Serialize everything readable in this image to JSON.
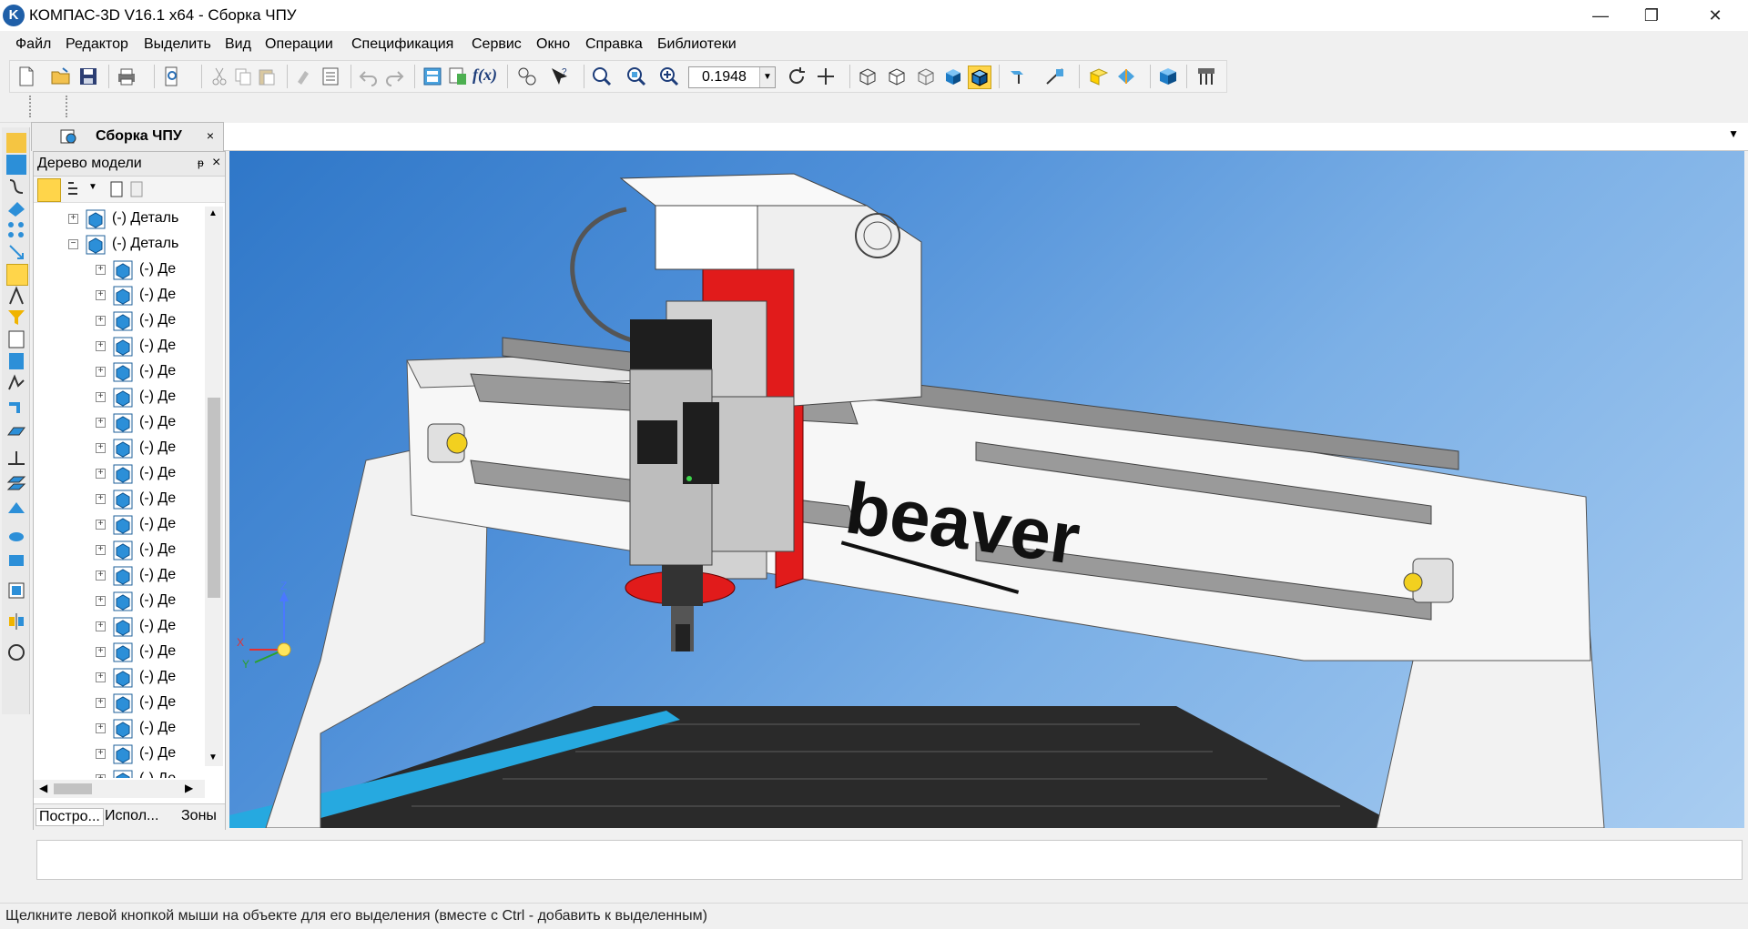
{
  "window": {
    "title": "КОМПАС-3D V16.1 x64 - Сборка ЧПУ",
    "logo_letter": "K",
    "controls": {
      "minimize": "—",
      "restore": "❐",
      "close": "✕"
    }
  },
  "menu": [
    "Файл",
    "Редактор",
    "Выделить",
    "Вид",
    "Операции",
    "Спецификация",
    "Сервис",
    "Окно",
    "Справка",
    "Библиотеки"
  ],
  "toolbar": {
    "zoom_value": "0.1948",
    "fx_label": "f(x)",
    "icons": [
      "new-document-icon",
      "open-folder-icon",
      "save-icon",
      "print-icon",
      "print-preview-icon",
      "cut-icon",
      "copy-icon",
      "paste-icon",
      "format-painter-icon",
      "properties-list-icon",
      "undo-icon",
      "redo-icon",
      "manager-icon",
      "tree-icon",
      "variables-icon",
      "numbering-icon",
      "help-pointer-icon",
      "zoom-window-icon",
      "zoom-fit-icon",
      "zoom-in-icon",
      "rotate-icon",
      "move-icon",
      "wireframe-icon",
      "hidden-lines-icon",
      "hidden-thin-icon",
      "shaded-icon",
      "shaded-edges-icon",
      "section-icon",
      "perspective-icon",
      "planes-icon",
      "orientation-icon",
      "render-icon",
      "settings-icon"
    ]
  },
  "document_tab": {
    "label": "Сборка ЧПУ",
    "close": "×"
  },
  "tree_panel": {
    "title": "Дерево модели",
    "pin": "ᵽ",
    "close": "×",
    "rows": [
      {
        "label": "(-) Деталь",
        "level": 1,
        "expander": "+"
      },
      {
        "label": "(-) Деталь",
        "level": 1,
        "expander": "−"
      },
      {
        "label": "(-) Де",
        "level": 2,
        "expander": "+"
      },
      {
        "label": "(-) Де",
        "level": 2,
        "expander": "+"
      },
      {
        "label": "(-) Де",
        "level": 2,
        "expander": "+"
      },
      {
        "label": "(-) Де",
        "level": 2,
        "expander": "+"
      },
      {
        "label": "(-) Де",
        "level": 2,
        "expander": "+"
      },
      {
        "label": "(-) Де",
        "level": 2,
        "expander": "+"
      },
      {
        "label": "(-) Де",
        "level": 2,
        "expander": "+"
      },
      {
        "label": "(-) Де",
        "level": 2,
        "expander": "+"
      },
      {
        "label": "(-) Де",
        "level": 2,
        "expander": "+"
      },
      {
        "label": "(-) Де",
        "level": 2,
        "expander": "+"
      },
      {
        "label": "(-) Де",
        "level": 2,
        "expander": "+"
      },
      {
        "label": "(-) Де",
        "level": 2,
        "expander": "+"
      },
      {
        "label": "(-) Де",
        "level": 2,
        "expander": "+"
      },
      {
        "label": "(-) Де",
        "level": 2,
        "expander": "+"
      },
      {
        "label": "(-) Де",
        "level": 2,
        "expander": "+"
      },
      {
        "label": "(-) Де",
        "level": 2,
        "expander": "+"
      },
      {
        "label": "(-) Де",
        "level": 2,
        "expander": "+"
      },
      {
        "label": "(-) Де",
        "level": 2,
        "expander": "+"
      },
      {
        "label": "(-) Де",
        "level": 2,
        "expander": "+"
      },
      {
        "label": "(-) Де",
        "level": 2,
        "expander": "+"
      },
      {
        "label": "(-) Де",
        "level": 2,
        "expander": "+"
      }
    ],
    "tabs": [
      "Постро...",
      "Испол...",
      "Зоны"
    ]
  },
  "viewport": {
    "logo_text": "beaver",
    "axes": {
      "x": "X",
      "y": "Y",
      "z": "Z"
    },
    "colors": {
      "frame": "#f2f2f2",
      "carriage": "#e11b1b",
      "spindle": "#bdbdbd",
      "table": "#2a2a2a",
      "rail": "#26a9e0"
    }
  },
  "status": "Щелкните левой кнопкой мыши на объекте для его выделения (вместе с Ctrl - добавить к выделенным)"
}
